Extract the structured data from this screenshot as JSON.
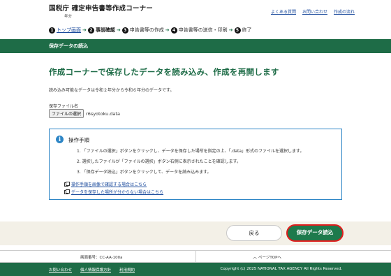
{
  "header": {
    "title": "国税庁 確定申告書等作成コーナー",
    "subtitle": "年分",
    "links": [
      "よくある質問",
      "お問い合わせ",
      "作成の流れ"
    ]
  },
  "steps": {
    "items": [
      {
        "num": "1",
        "label": "トップ画面"
      },
      {
        "num": "2",
        "label": "事前確認"
      },
      {
        "num": "3",
        "label": "申告書等の作成"
      },
      {
        "num": "4",
        "label": "申告書等の送信・印刷"
      },
      {
        "num": "5",
        "label": "終了"
      }
    ],
    "arrow": "➔"
  },
  "section_bar": {
    "title": "保存データの読込"
  },
  "main": {
    "heading": "作成コーナーで保存したデータを読み込み、作成を再開します",
    "note": "読み込み可能なデータは令和２年分から令和６年分のデータです。",
    "file_label": "保存ファイル名",
    "file_button": "ファイルの選択",
    "file_name": "r6syotoku.data"
  },
  "procedure": {
    "icon": "info-icon",
    "title": "操作手順",
    "steps": [
      "1. 「ファイルの選択」ボタンをクリックし、データを保存した場所を指定の上、「.data」形式のファイルを選択します。",
      "2. 選択したファイルが「ファイルの選択」ボタン右側に表示されたことを確認します。",
      "3. 「保存データ読込」ボタンをクリックして、データを読み込みます。"
    ],
    "links": [
      "操作手順を画像で確認する場合はこちら",
      "データを保存した場所が分からない場合はこちら"
    ]
  },
  "actions": {
    "back": "戻る",
    "load": "保存データ読込"
  },
  "info_bar": {
    "screen_no": "画面番号：CC-AA-100a",
    "page_top": "ページTOPへ"
  },
  "footer": {
    "links": [
      "お問い合わせ",
      "個人情報保護方針",
      "利用規約"
    ],
    "copyright": "Copyright (c) 2025 NATIONAL TAX AGENCY All Rights Reserved."
  },
  "colors": {
    "brand_green": "#1e6c47",
    "link_blue": "#1a4a9c",
    "info_blue": "#2e86c6",
    "highlight_red": "#e11d1d"
  }
}
